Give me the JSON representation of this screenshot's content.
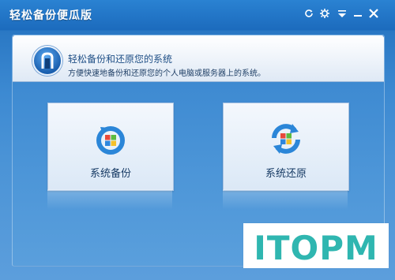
{
  "window": {
    "title": "轻松备份便瓜版"
  },
  "titlebar_buttons": [
    {
      "name": "refresh-button",
      "glyph": "⟳"
    },
    {
      "name": "settings-button",
      "glyph": "⚙"
    },
    {
      "name": "menu-button",
      "glyph": "⯆"
    },
    {
      "name": "minimize-button",
      "glyph": "—"
    },
    {
      "name": "close-button",
      "glyph": "✕"
    }
  ],
  "header": {
    "title": "轻松备份和还原您的系统",
    "subtitle": "方便快速地备份和还原您的个人电脑或服务器上的系统。"
  },
  "actions": {
    "backup_label": "系统备份",
    "restore_label": "系统还原"
  },
  "watermark": {
    "text": "ITOPM"
  },
  "colors": {
    "accent": "#1c6bbd",
    "card_text": "#163a64",
    "watermark_teal": "#2fb6b0"
  },
  "icons": {
    "badge": "door-shield-icon",
    "backup": "windows-backup-icon",
    "restore": "windows-restore-icon"
  }
}
